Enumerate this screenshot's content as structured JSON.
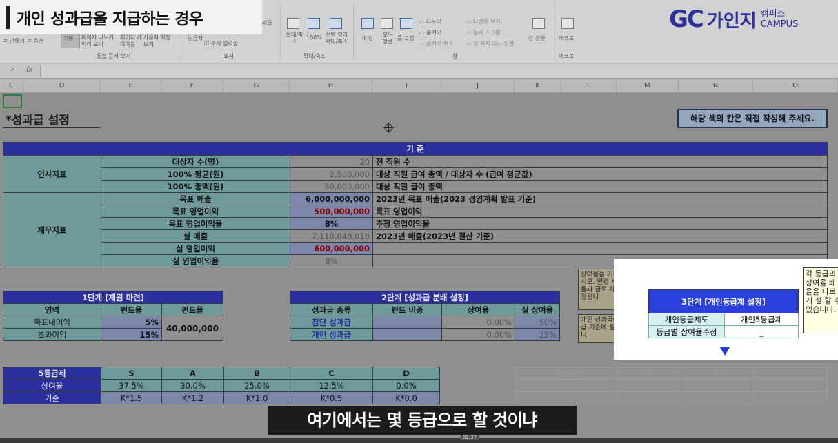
{
  "overlay": {
    "title": "개인 성과급을 지급하는 경우",
    "logo_mark": "GC",
    "logo_name": "가인지",
    "logo_sub1": "캠퍼스",
    "logo_sub2": "CAMPUS",
    "subtitle": "여기에서는 몇 등급으로 할 것이냐",
    "time": "02:37"
  },
  "ribbon": {
    "page_break": "기본",
    "page_layout": "페이지 나누기 미리 보기",
    "page_layout2": "페이지 레이아웃",
    "custom_view": "사용자 지정 보기",
    "group_views": "통합 문서 보기",
    "ruler": "눈금자",
    "formula_bar_chk": "수식 입력줄",
    "group_show": "표시",
    "zoom": "확대/축소",
    "zoom100": "100%",
    "zoom_sel": "선택 영역 확대/축소",
    "group_zoom": "확대/축소",
    "new_window": "새 창",
    "arrange_all": "모두 정렬",
    "freeze": "틀 고정",
    "split": "나누기",
    "hide": "숨기기",
    "unhide": "숨기기 취소",
    "side_by_side": "나란히 보기",
    "sync_scroll": "동시 스크롤",
    "reset_pos": "창 위치 다시 정렬",
    "switch": "창 전환",
    "group_window": "창",
    "macro": "매크로",
    "group_macro": "매크로"
  },
  "formula_bar": {
    "cancel": "✓",
    "fx": "fx"
  },
  "columns": [
    "C",
    "D",
    "E",
    "F",
    "G",
    "H",
    "I",
    "J",
    "K",
    "L",
    "M",
    "N",
    "O"
  ],
  "section_title": "*성과급 설정",
  "note": "해당 색의 칸은 직접 작성해 주세요.",
  "main_table": {
    "header": "기  준",
    "hr_label": "인사지표",
    "fin_label": "재무지표",
    "rows": [
      {
        "label": "대상자 수(명)",
        "value": "20",
        "desc": "전 직원 수"
      },
      {
        "label": "100% 평균(원)",
        "value": "2,500,000",
        "desc": "대상 직원 급여 총액 / 대상자 수 (급여 평균값)"
      },
      {
        "label": "100% 총액(원)",
        "value": "50,000,000",
        "desc": "대상 직원 급여 총액"
      },
      {
        "label": "목표 매출",
        "value": "6,000,000,000",
        "desc": "2023년 목표 매출(2023 경영계획 발표 기준)"
      },
      {
        "label": "목표 영업이익",
        "value": "500,000,000",
        "desc": "목표 영업이익"
      },
      {
        "label": "목표 영업이익율",
        "value": "8%",
        "desc": "추정 영업이익율"
      },
      {
        "label": "실 매출",
        "value": "7,110,048,018",
        "desc": "2023년 매출(2023년 결산 기준)"
      },
      {
        "label": "실 영업이익",
        "value": "600,000,000",
        "desc": ""
      },
      {
        "label": "실 영업이익율",
        "value": "8%",
        "desc": ""
      }
    ]
  },
  "step1": {
    "header": "1단계 [재원 마련]",
    "cols": [
      "영역",
      "펀드율",
      "펀드율"
    ],
    "rows": [
      {
        "area": "목표내이익",
        "rate": "5%"
      },
      {
        "area": "초과이익",
        "rate": "15%"
      }
    ],
    "total": "40,000,000"
  },
  "step2": {
    "header": "2단계 [성과급 분배 설정]",
    "cols": [
      "성과급 종류",
      "펀드 비중",
      "상여율",
      "실 상여율"
    ],
    "rows": [
      {
        "type": "집단 성과급",
        "weight": "",
        "rate": "0.00%",
        "real": "50%"
      },
      {
        "type": "개인 성과급",
        "weight": "",
        "rate": "0.00%",
        "real": "25%"
      }
    ]
  },
  "callouts": {
    "c1": "상여율을 기하주십시오. 변경 시 상여율과 금로 자동 설정됩니",
    "c2": "개인 성과급에 등급 기준에 설정됩니",
    "c3": "각 등급의 상여율 배율을 다르게 설 할 수 있습니다."
  },
  "step3": {
    "header": "3단계 [개인등급제 설정]",
    "rows": [
      {
        "label": "개인등급제도",
        "value": "개인5등급제"
      },
      {
        "label": "등급별 상여율수정",
        "value": "_"
      }
    ]
  },
  "grade5": {
    "header": "5등급제",
    "grades": [
      "S",
      "A",
      "B",
      "C",
      "D"
    ],
    "rate_label": "상여율",
    "rates": [
      "37.5%",
      "30.0%",
      "25.0%",
      "12.5%",
      "0.0%"
    ],
    "basis_label": "기준",
    "basis": [
      "K*1.5",
      "K*1.2",
      "K*1.0",
      "K*0.5",
      "K*0.0"
    ]
  },
  "ghost4": {
    "header": "4등급제",
    "grades": [
      "A",
      "B",
      "C"
    ]
  }
}
